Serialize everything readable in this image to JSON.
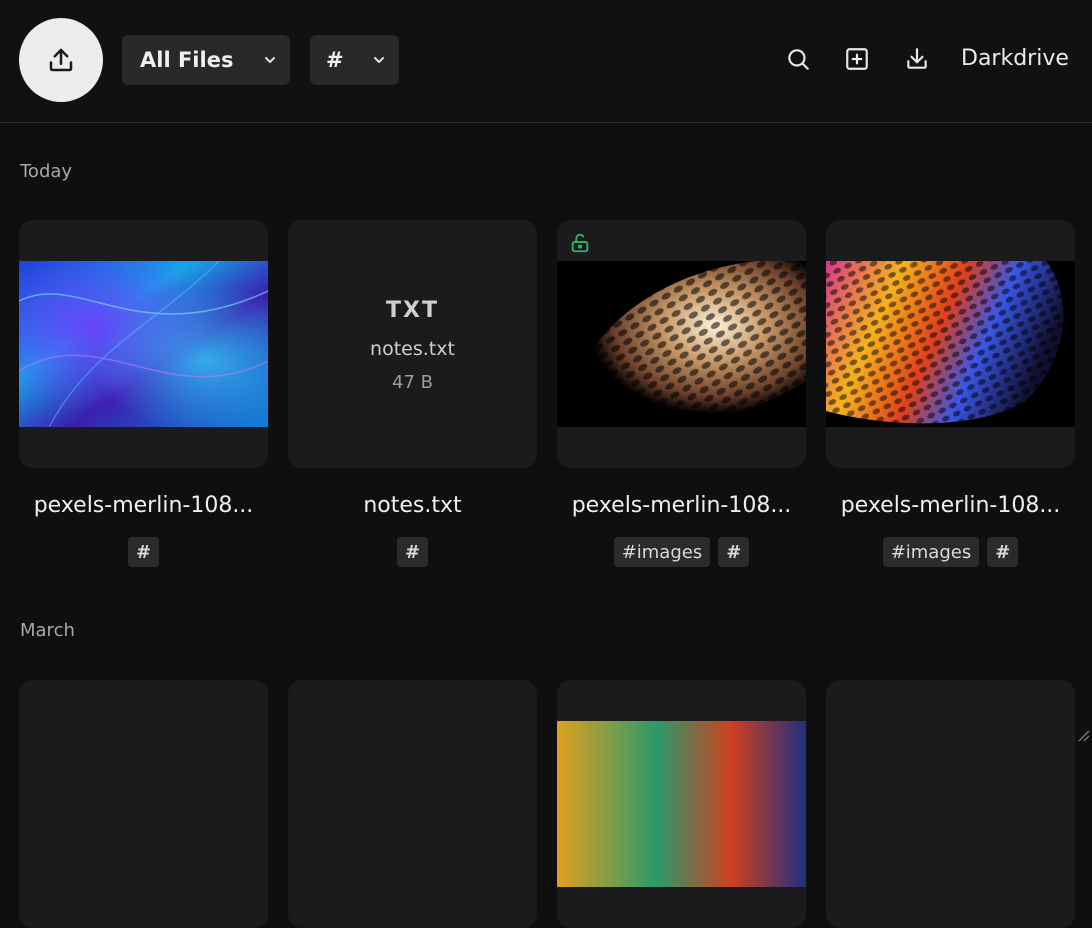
{
  "toolbar": {
    "upload_icon": "upload-icon",
    "filter_label": "All Files",
    "tag_filter_label": "#",
    "search_icon": "search-icon",
    "add_icon": "add-square-icon",
    "download_icon": "download-icon",
    "brand": "Darkdrive"
  },
  "sections": [
    {
      "label": "Today",
      "files": [
        {
          "name": "pexels-merlin-108...",
          "type": "image",
          "tags": [
            "#"
          ]
        },
        {
          "name": "notes.txt",
          "type": "text",
          "ext": "TXT",
          "inner_name": "notes.txt",
          "size": "47 B",
          "tags": [
            "#"
          ]
        },
        {
          "name": "pexels-merlin-108...",
          "type": "image",
          "unlocked": true,
          "tags": [
            "#images",
            "#"
          ]
        },
        {
          "name": "pexels-merlin-108...",
          "type": "image",
          "tags": [
            "#images",
            "#"
          ]
        }
      ]
    },
    {
      "label": "March",
      "files": []
    }
  ],
  "colors": {
    "background": "#0f0f10",
    "card": "#1b1b1d",
    "tag": "#2b2b2e",
    "unlock_green": "#2fb56a"
  }
}
